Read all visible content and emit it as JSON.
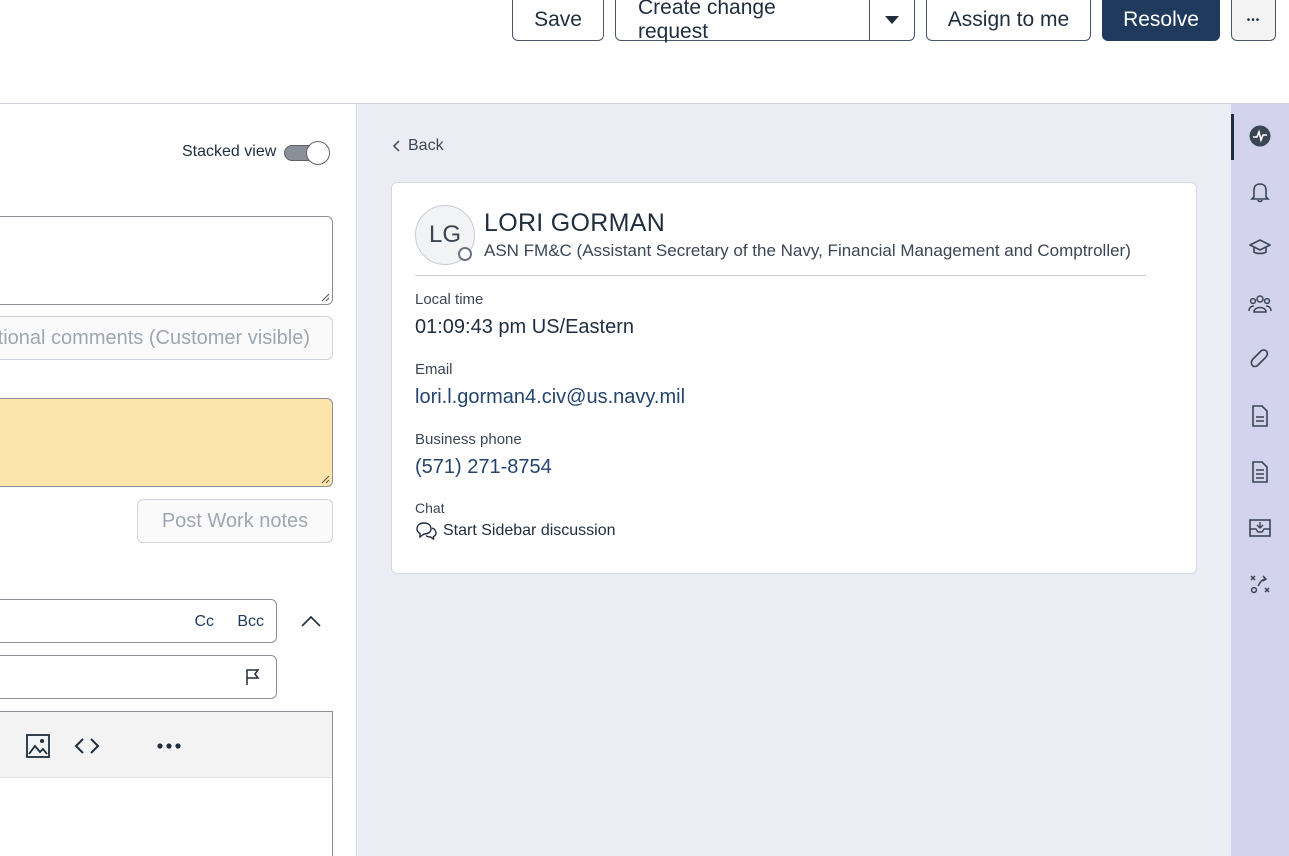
{
  "header": {
    "save_label": "Save",
    "create_change_label": "Create change request",
    "assign_label": "Assign to me",
    "resolve_label": "Resolve",
    "more_label": "•••"
  },
  "form": {
    "stacked_view_label": "Stacked view",
    "additional_comments_label": "Additional comments (Customer visible)",
    "post_work_notes_label": "Post Work notes",
    "cc_label": "Cc",
    "bcc_label": "Bcc"
  },
  "contact": {
    "back_label": "Back",
    "initials": "LG",
    "name": "LORI GORMAN",
    "department": "ASN FM&C (Assistant Secretary of the Navy, Financial Management and Comptroller)",
    "local_time_label": "Local time",
    "local_time": "01:09:43 pm US/Eastern",
    "email_label": "Email",
    "email": "lori.l.gorman4.civ@us.navy.mil",
    "phone_label": "Business phone",
    "phone": "(571) 271-8754",
    "chat_label": "Chat",
    "chat_link": "Start Sidebar discussion"
  },
  "rail": {
    "items": [
      "activity-icon",
      "bell-icon",
      "graduation-cap-icon",
      "group-icon",
      "paperclip-icon",
      "document-icon",
      "document-lines-icon",
      "inbox-icon",
      "agent-assist-icon"
    ]
  },
  "colors": {
    "primary": "#1f3a5c",
    "worknote_bg": "#fde4ab",
    "panel_bg": "#ececf4",
    "rail_bg": "#d3d3ee"
  }
}
